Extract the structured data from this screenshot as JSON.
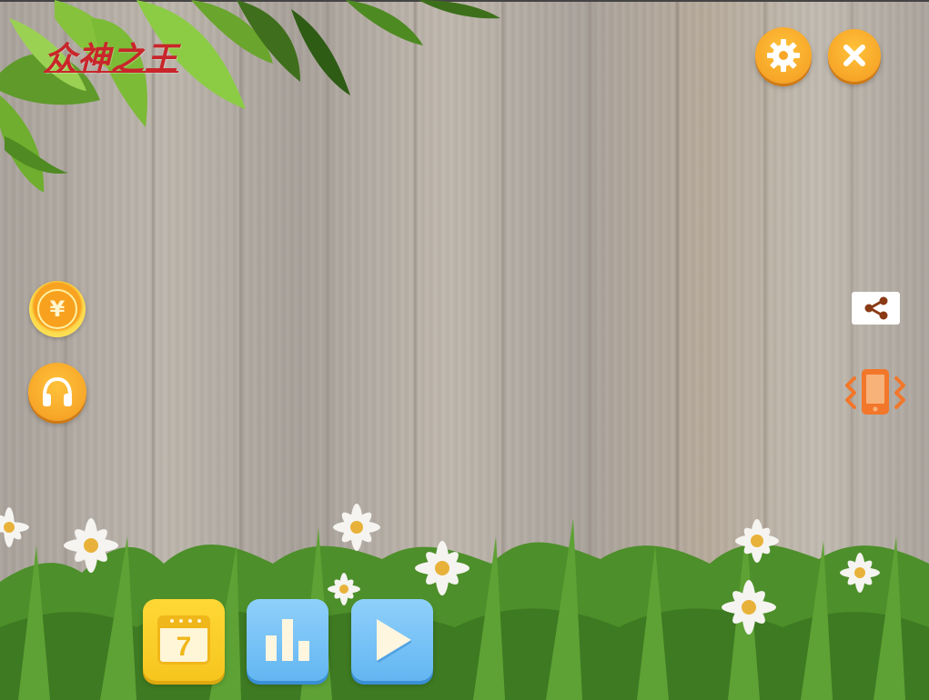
{
  "app": {
    "title": "众神之王"
  },
  "top_right": {
    "settings_icon": "gear-icon",
    "close_icon": "close-icon"
  },
  "left_side": {
    "coin_icon": "yuan-coin-icon",
    "coin_symbol": "¥",
    "audio_icon": "headphones-icon"
  },
  "right_side": {
    "share_icon": "share-icon",
    "vibrate_icon": "vibrate-phone-icon"
  },
  "bottom_bar": {
    "calendar_icon": "calendar-icon",
    "calendar_day": "7",
    "stats_icon": "bar-chart-icon",
    "play_icon": "play-icon"
  },
  "colors": {
    "accent_orange": "#f7a628",
    "title_red": "#c9252a",
    "yellow_button": "#f6c51e",
    "blue_button": "#63b6f2",
    "share_icon": "#8a3a14",
    "vibrate_icon": "#f2772a"
  }
}
